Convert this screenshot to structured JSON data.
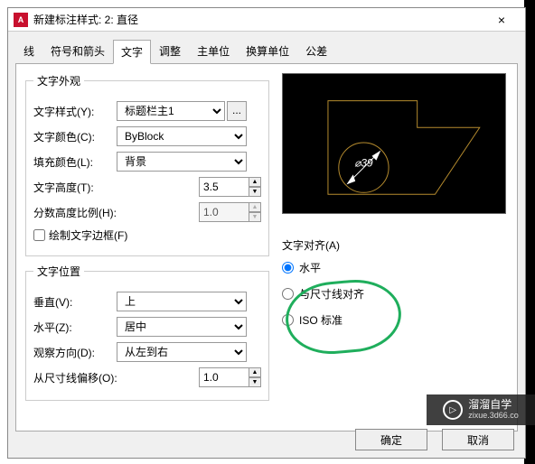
{
  "titlebar": {
    "logo": "A",
    "title": "新建标注样式: 2: 直径",
    "close": "×"
  },
  "tabs": {
    "line": "线",
    "arrows": "符号和箭头",
    "text": "文字",
    "fit": "调整",
    "primary": "主单位",
    "alt": "换算单位",
    "tol": "公差"
  },
  "appearance": {
    "legend": "文字外观",
    "styleLabel": "文字样式(Y):",
    "styleValue": "标题栏主1",
    "dots": "...",
    "colorLabel": "文字颜色(C):",
    "colorValue": "ByBlock",
    "fillLabel": "填充颜色(L):",
    "fillValue": "背景",
    "heightLabel": "文字高度(T):",
    "heightValue": "3.5",
    "fracLabel": "分数高度比例(H):",
    "fracValue": "1.0",
    "frameLabel": "绘制文字边框(F)"
  },
  "position": {
    "legend": "文字位置",
    "vertLabel": "垂直(V):",
    "vertValue": "上",
    "horzLabel": "水平(Z):",
    "horzValue": "居中",
    "viewLabel": "观察方向(D):",
    "viewValue": "从左到右",
    "offsetLabel": "从尺寸线偏移(O):",
    "offsetValue": "1.0"
  },
  "align": {
    "legend": "文字对齐(A)",
    "horiz": "水平",
    "dim": "与尺寸线对齐",
    "iso": "ISO 标准"
  },
  "preview": {
    "dimText": "⌀39"
  },
  "footer": {
    "ok": "确定",
    "cancel": "取消"
  },
  "watermark": {
    "play": "▷",
    "brand": "溜溜自学",
    "url": "zixue.3d66.co"
  }
}
